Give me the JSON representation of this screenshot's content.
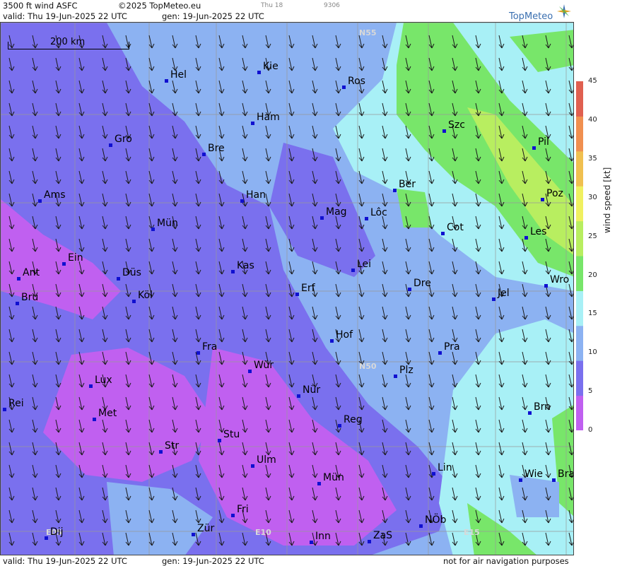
{
  "header": {
    "title": "3500 ft wind ASFC",
    "copyright": "©2025 TopMeteo.eu",
    "run_label": "Thu 18",
    "run_code": "9306",
    "valid": "valid:  Thu  19-Jun-2025  22 UTC",
    "gen": "gen: 19-Jun-2025 22 UTC"
  },
  "footer": {
    "valid": "valid:  Thu  19-Jun-2025  22 UTC",
    "gen": "gen: 19-Jun-2025 22 UTC",
    "disclaimer": "not for air navigation purposes"
  },
  "logo": {
    "text": "TopMeteo"
  },
  "scale": {
    "label": "200 km"
  },
  "grid_labels": [
    {
      "text": "N55"
    },
    {
      "text": "N50"
    },
    {
      "text": "E05"
    },
    {
      "text": "E10"
    },
    {
      "text": "E15"
    }
  ],
  "cities": [
    {
      "name": "Kie"
    },
    {
      "name": "Hel"
    },
    {
      "name": "Ros"
    },
    {
      "name": "Ham"
    },
    {
      "name": "Szc"
    },
    {
      "name": "Gro"
    },
    {
      "name": "Bre"
    },
    {
      "name": "Pil"
    },
    {
      "name": "Ber"
    },
    {
      "name": "Ams"
    },
    {
      "name": "Han"
    },
    {
      "name": "Poz"
    },
    {
      "name": "Mag"
    },
    {
      "name": "Lôc"
    },
    {
      "name": "Mün"
    },
    {
      "name": "Cot"
    },
    {
      "name": "Les"
    },
    {
      "name": "Ein"
    },
    {
      "name": "Kas"
    },
    {
      "name": "Lei"
    },
    {
      "name": "Ant"
    },
    {
      "name": "Düs"
    },
    {
      "name": "Wro"
    },
    {
      "name": "Dre"
    },
    {
      "name": "Erf"
    },
    {
      "name": "Köl"
    },
    {
      "name": "Jel"
    },
    {
      "name": "Bru"
    },
    {
      "name": "Hof"
    },
    {
      "name": "Fra"
    },
    {
      "name": "Pra"
    },
    {
      "name": "Wür"
    },
    {
      "name": "Plz"
    },
    {
      "name": "Lux"
    },
    {
      "name": "Nür"
    },
    {
      "name": "Rei"
    },
    {
      "name": "Brn"
    },
    {
      "name": "Met"
    },
    {
      "name": "Reg"
    },
    {
      "name": "Stu"
    },
    {
      "name": "Str"
    },
    {
      "name": "Ulm"
    },
    {
      "name": "Lin"
    },
    {
      "name": "Wie"
    },
    {
      "name": "Bra"
    },
    {
      "name": "Mün"
    },
    {
      "name": "Fri"
    },
    {
      "name": "NÖb"
    },
    {
      "name": "Dij"
    },
    {
      "name": "Zür"
    },
    {
      "name": "Inn"
    },
    {
      "name": "ZaS"
    }
  ],
  "legend": {
    "title": "wind speed  [kt]",
    "ticks": [
      "45",
      "40",
      "35",
      "30",
      "25",
      "20",
      "15",
      "10",
      "5",
      "0"
    ],
    "colors": [
      "#c060f0",
      "#7a70ee",
      "#8cb2f2",
      "#a8f0f6",
      "#78e66a",
      "#b8ee60",
      "#f0f060",
      "#f0c050",
      "#f09050",
      "#e06050"
    ]
  },
  "wind_field": {
    "direction": "north-northwest",
    "max_kt": 25
  }
}
